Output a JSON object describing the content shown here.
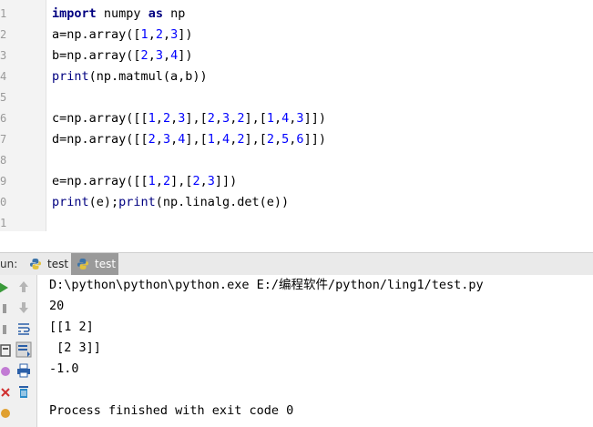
{
  "editor": {
    "line_numbers": [
      "1",
      "2",
      "3",
      "4",
      "5",
      "6",
      "7",
      "8",
      "9",
      "0",
      "1"
    ],
    "lines": [
      {
        "parts": [
          {
            "t": "import",
            "c": "kw"
          },
          {
            "t": " numpy ",
            "c": ""
          },
          {
            "t": "as",
            "c": "kw"
          },
          {
            "t": " np",
            "c": ""
          }
        ]
      },
      {
        "parts": [
          {
            "t": "a=np.array([",
            "c": ""
          },
          {
            "t": "1",
            "c": "nm"
          },
          {
            "t": ",",
            "c": ""
          },
          {
            "t": "2",
            "c": "nm"
          },
          {
            "t": ",",
            "c": ""
          },
          {
            "t": "3",
            "c": "nm"
          },
          {
            "t": "])",
            "c": ""
          }
        ]
      },
      {
        "parts": [
          {
            "t": "b=np.array([",
            "c": ""
          },
          {
            "t": "2",
            "c": "nm"
          },
          {
            "t": ",",
            "c": ""
          },
          {
            "t": "3",
            "c": "nm"
          },
          {
            "t": ",",
            "c": ""
          },
          {
            "t": "4",
            "c": "nm"
          },
          {
            "t": "])",
            "c": ""
          }
        ]
      },
      {
        "parts": [
          {
            "t": "print",
            "c": "bi"
          },
          {
            "t": "(np.matmul(a,b))",
            "c": ""
          }
        ]
      },
      {
        "parts": []
      },
      {
        "parts": [
          {
            "t": "c=np.array([[",
            "c": ""
          },
          {
            "t": "1",
            "c": "nm"
          },
          {
            "t": ",",
            "c": ""
          },
          {
            "t": "2",
            "c": "nm"
          },
          {
            "t": ",",
            "c": ""
          },
          {
            "t": "3",
            "c": "nm"
          },
          {
            "t": "],[",
            "c": ""
          },
          {
            "t": "2",
            "c": "nm"
          },
          {
            "t": ",",
            "c": ""
          },
          {
            "t": "3",
            "c": "nm"
          },
          {
            "t": ",",
            "c": ""
          },
          {
            "t": "2",
            "c": "nm"
          },
          {
            "t": "],[",
            "c": ""
          },
          {
            "t": "1",
            "c": "nm"
          },
          {
            "t": ",",
            "c": ""
          },
          {
            "t": "4",
            "c": "nm"
          },
          {
            "t": ",",
            "c": ""
          },
          {
            "t": "3",
            "c": "nm"
          },
          {
            "t": "]])",
            "c": ""
          }
        ]
      },
      {
        "parts": [
          {
            "t": "d=np.array([[",
            "c": ""
          },
          {
            "t": "2",
            "c": "nm"
          },
          {
            "t": ",",
            "c": ""
          },
          {
            "t": "3",
            "c": "nm"
          },
          {
            "t": ",",
            "c": ""
          },
          {
            "t": "4",
            "c": "nm"
          },
          {
            "t": "],[",
            "c": ""
          },
          {
            "t": "1",
            "c": "nm"
          },
          {
            "t": ",",
            "c": ""
          },
          {
            "t": "4",
            "c": "nm"
          },
          {
            "t": ",",
            "c": ""
          },
          {
            "t": "2",
            "c": "nm"
          },
          {
            "t": "],[",
            "c": ""
          },
          {
            "t": "2",
            "c": "nm"
          },
          {
            "t": ",",
            "c": ""
          },
          {
            "t": "5",
            "c": "nm"
          },
          {
            "t": ",",
            "c": ""
          },
          {
            "t": "6",
            "c": "nm"
          },
          {
            "t": "]])",
            "c": ""
          }
        ]
      },
      {
        "parts": []
      },
      {
        "parts": [
          {
            "t": "e=np.array([[",
            "c": ""
          },
          {
            "t": "1",
            "c": "nm"
          },
          {
            "t": ",",
            "c": ""
          },
          {
            "t": "2",
            "c": "nm"
          },
          {
            "t": "],[",
            "c": ""
          },
          {
            "t": "2",
            "c": "nm"
          },
          {
            "t": ",",
            "c": ""
          },
          {
            "t": "3",
            "c": "nm"
          },
          {
            "t": "]])",
            "c": ""
          }
        ]
      },
      {
        "parts": [
          {
            "t": "print",
            "c": "bi"
          },
          {
            "t": "(e);",
            "c": ""
          },
          {
            "t": "print",
            "c": "bi"
          },
          {
            "t": "(np.linalg.det(e))",
            "c": ""
          }
        ]
      },
      {
        "parts": []
      }
    ]
  },
  "run_panel": {
    "label": "un:",
    "tabs": [
      "test",
      "test"
    ]
  },
  "console": {
    "lines": [
      "D:\\python\\python\\python.exe E:/编程软件/python/ling1/test.py",
      "20",
      "[[1 2]",
      " [2 3]]",
      "-1.0",
      "",
      "Process finished with exit code 0"
    ]
  },
  "colors": {
    "keyword": "#000080",
    "number": "#0000ff",
    "run_green": "#3a9a3a",
    "stop_red": "#d03030"
  },
  "toolbar_icons": [
    "run-icon",
    "rerun-up-icon",
    "stop-icon",
    "down-arrow-icon",
    "pause-icon",
    "soft-wrap-icon",
    "settings-icon",
    "scroll-end-icon",
    "close-icon",
    "print-icon",
    "trash-icon"
  ]
}
